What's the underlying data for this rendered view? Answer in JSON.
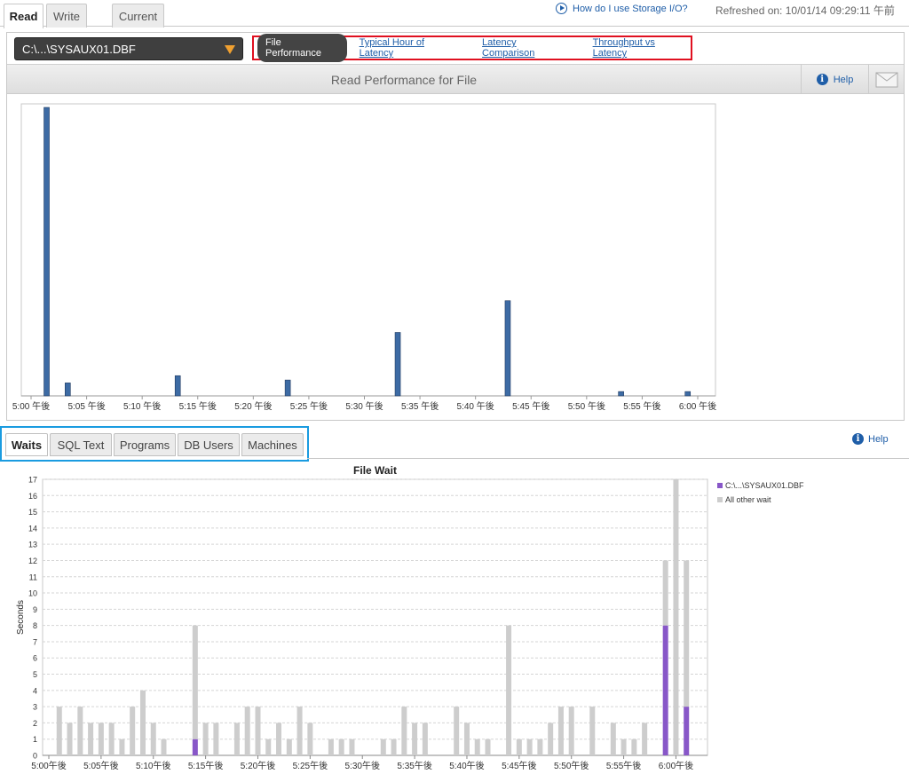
{
  "top_tabs": [
    "Read",
    "Write",
    "Current"
  ],
  "howto_label": "How do I use Storage I/O?",
  "refreshed": "Refreshed on: 10/01/14 09:29:11 午前",
  "file_select": "C:\\...\\SYSAUX01.DBF",
  "view_tabs": {
    "active": "File Performance",
    "links": [
      "Typical Hour of Latency",
      "Latency Comparison",
      "Throughput vs Latency"
    ]
  },
  "panel_title": "Read Performance for File",
  "help_label": "Help",
  "lower_tabs": [
    "Waits",
    "SQL Text",
    "Programs",
    "DB Users",
    "Machines"
  ],
  "lower_help": "Help",
  "colors": {
    "bar_blue": "#3d6ba4",
    "file_purple": "#8857c8",
    "other_gray": "#cdcdcd",
    "select_red": "#e01020",
    "tab_blue": "#1a9be0"
  },
  "chart_data": [
    {
      "type": "bar",
      "x_range_minutes": [
        0,
        60
      ],
      "tick_labels": [
        "5:00 午後",
        "5:05 午後",
        "5:10 午後",
        "5:15 午後",
        "5:20 午後",
        "5:25 午後",
        "5:30 午後",
        "5:35 午後",
        "5:40 午後",
        "5:45 午後",
        "5:50 午後",
        "5:55 午後",
        "6:00 午後"
      ],
      "points": [
        {
          "minute": 1.4,
          "value": 100
        },
        {
          "minute": 3.3,
          "value": 4.5
        },
        {
          "minute": 13.2,
          "value": 7
        },
        {
          "minute": 23.1,
          "value": 5.5
        },
        {
          "minute": 33.0,
          "value": 22
        },
        {
          "minute": 42.9,
          "value": 33
        },
        {
          "minute": 53.1,
          "value": 1.5
        },
        {
          "minute": 59.1,
          "value": 1.5
        }
      ],
      "ylim": [
        0,
        100
      ]
    },
    {
      "type": "bar",
      "title": "File Wait",
      "ylabel": "Seconds",
      "ylim": [
        0,
        17
      ],
      "y_ticks": [
        0,
        1,
        2,
        3,
        4,
        5,
        6,
        7,
        8,
        9,
        10,
        11,
        12,
        13,
        14,
        15,
        16,
        17
      ],
      "x_range_minutes": [
        0,
        62
      ],
      "tick_labels": [
        "5:00午後",
        "5:05午後",
        "5:10午後",
        "5:15午後",
        "5:20午後",
        "5:25午後",
        "5:30午後",
        "5:35午後",
        "5:40午後",
        "5:45午後",
        "5:50午後",
        "5:55午後",
        "6:00午後"
      ],
      "legend": [
        "C:\\...\\SYSAUX01.DBF",
        "All other wait"
      ],
      "legend_position": "top-right",
      "minutes": [
        1,
        2,
        3,
        4,
        5,
        6,
        7,
        8,
        9,
        10,
        11,
        12,
        13,
        14,
        15,
        16,
        17,
        18,
        19,
        20,
        21,
        22,
        23,
        24,
        25,
        26,
        27,
        28,
        29,
        30,
        31,
        32,
        33,
        34,
        35,
        36,
        37,
        38,
        39,
        40,
        41,
        42,
        43,
        44,
        45,
        46,
        47,
        48,
        49,
        50,
        51,
        52,
        53,
        54,
        55,
        56,
        57,
        58,
        59,
        60,
        61
      ],
      "series": [
        {
          "name": "C:\\...\\SYSAUX01.DBF",
          "values": [
            0,
            0,
            0,
            0,
            0,
            0,
            0,
            0,
            0,
            0,
            0,
            0,
            0,
            1,
            0,
            0,
            0,
            0,
            0,
            0,
            0,
            0,
            0,
            0,
            0,
            0,
            0,
            0,
            0,
            0,
            0,
            0,
            0,
            0,
            0,
            0,
            0,
            0,
            0,
            0,
            0,
            0,
            0,
            0,
            0,
            0,
            0,
            0,
            0,
            0,
            0,
            0,
            0,
            0,
            0,
            0,
            0,
            0,
            8,
            0,
            3
          ]
        },
        {
          "name": "All other wait",
          "values": [
            3,
            2,
            3,
            2,
            2,
            2,
            1,
            3,
            4,
            2,
            1,
            0,
            0,
            7,
            2,
            2,
            0,
            2,
            3,
            3,
            1,
            2,
            1,
            3,
            2,
            0,
            1,
            1,
            1,
            0,
            0,
            1,
            1,
            3,
            2,
            2,
            0,
            0,
            3,
            2,
            1,
            1,
            0,
            8,
            1,
            1,
            1,
            2,
            3,
            3,
            0,
            3,
            0,
            2,
            1,
            1,
            2,
            0,
            4,
            17,
            9
          ]
        }
      ]
    }
  ]
}
